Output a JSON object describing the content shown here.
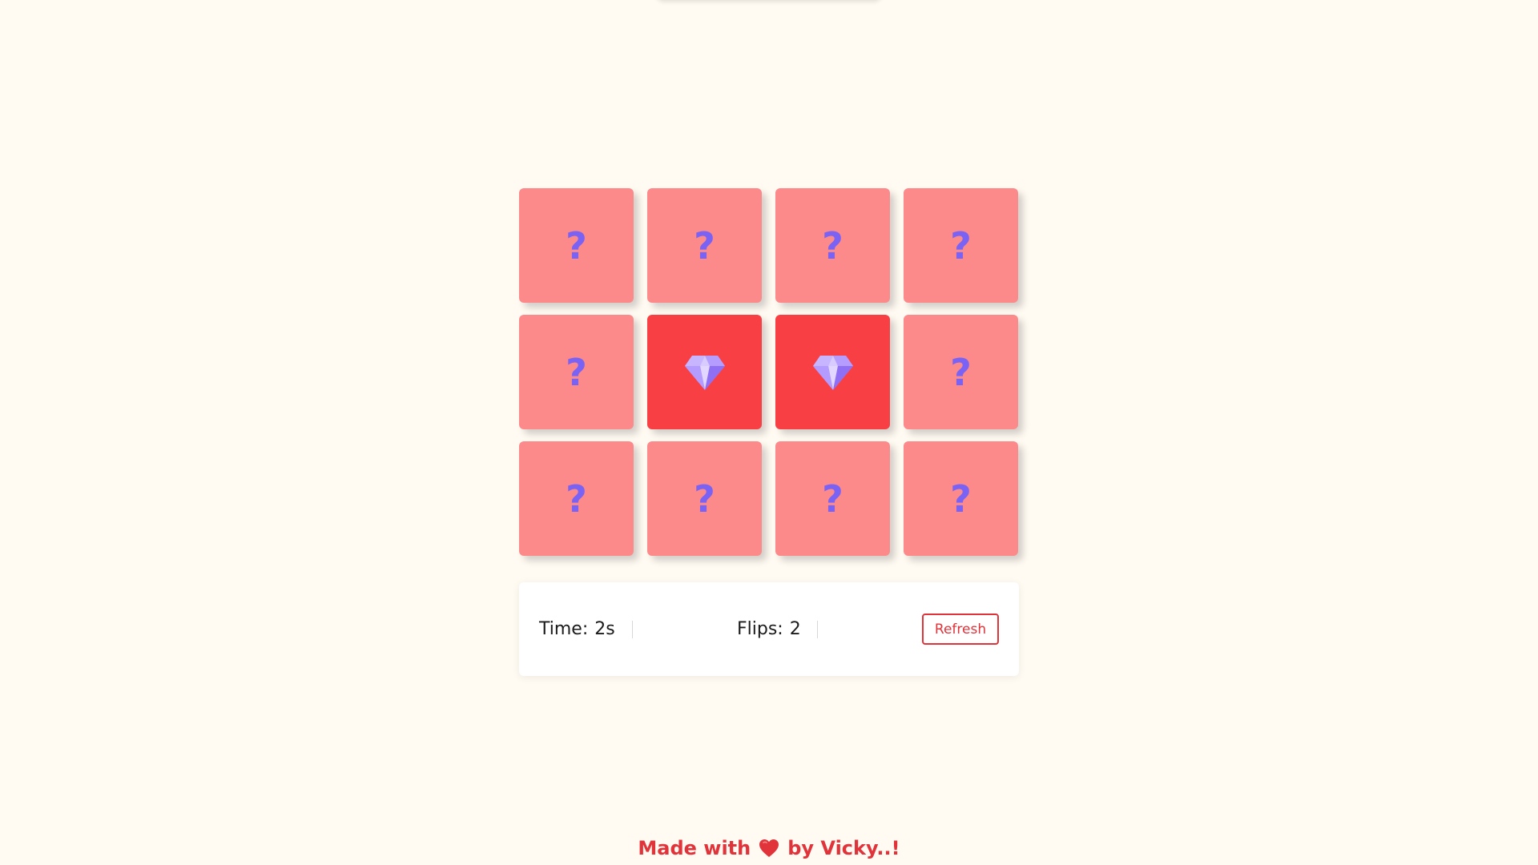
{
  "board": {
    "cards": [
      {
        "state": "hidden",
        "symbol": "?",
        "icon": "question-mark"
      },
      {
        "state": "hidden",
        "symbol": "?",
        "icon": "question-mark"
      },
      {
        "state": "hidden",
        "symbol": "?",
        "icon": "question-mark"
      },
      {
        "state": "hidden",
        "symbol": "?",
        "icon": "question-mark"
      },
      {
        "state": "hidden",
        "symbol": "?",
        "icon": "question-mark"
      },
      {
        "state": "flipped",
        "symbol": "",
        "icon": "gem-icon"
      },
      {
        "state": "flipped",
        "symbol": "",
        "icon": "gem-icon"
      },
      {
        "state": "hidden",
        "symbol": "?",
        "icon": "question-mark"
      },
      {
        "state": "hidden",
        "symbol": "?",
        "icon": "question-mark"
      },
      {
        "state": "hidden",
        "symbol": "?",
        "icon": "question-mark"
      },
      {
        "state": "hidden",
        "symbol": "?",
        "icon": "question-mark"
      },
      {
        "state": "hidden",
        "symbol": "?",
        "icon": "question-mark"
      }
    ]
  },
  "stats": {
    "time_label": "Time:",
    "time_value": "2s",
    "flips_label": "Flips:",
    "flips_value": "2",
    "refresh_label": "Refresh"
  },
  "footer": {
    "prefix": "Made with",
    "suffix": "by Vicky..!",
    "icon": "heart-icon"
  },
  "colors": {
    "background": "#fffbf3",
    "card_hidden": "#fd8a8a",
    "card_flipped": "#f84044",
    "question_mark": "#7a63f4",
    "accent": "#e0333a"
  }
}
